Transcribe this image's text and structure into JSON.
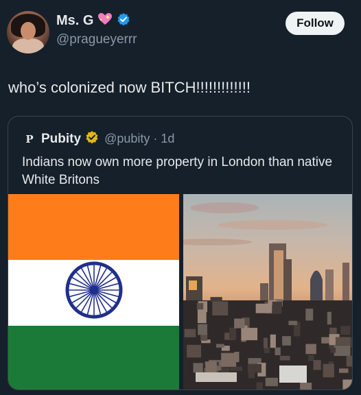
{
  "author": {
    "display_name": "Ms. G",
    "handle": "@pragueyerrr"
  },
  "follow_button": {
    "label": "Follow"
  },
  "tweet_text": "who’s colonized now BITCH!!!!!!!!!!!!!",
  "quoted_tweet": {
    "avatar_letter": "P",
    "name": "Pubity",
    "handle_time": "@pubity · 1d",
    "text": "Indians now own more property in London than native White Britons"
  },
  "colors": {
    "background": "#15202b",
    "saffron": "#fe7c1a",
    "flag_green": "#1c7a39",
    "chakra_blue": "#1f2f8c",
    "verified_blue": "#1d9bf0",
    "gold_badge": "#e2b719"
  },
  "icons": [
    "sparkling-heart-icon",
    "verified-badge-icon",
    "gold-verified-badge-icon"
  ]
}
